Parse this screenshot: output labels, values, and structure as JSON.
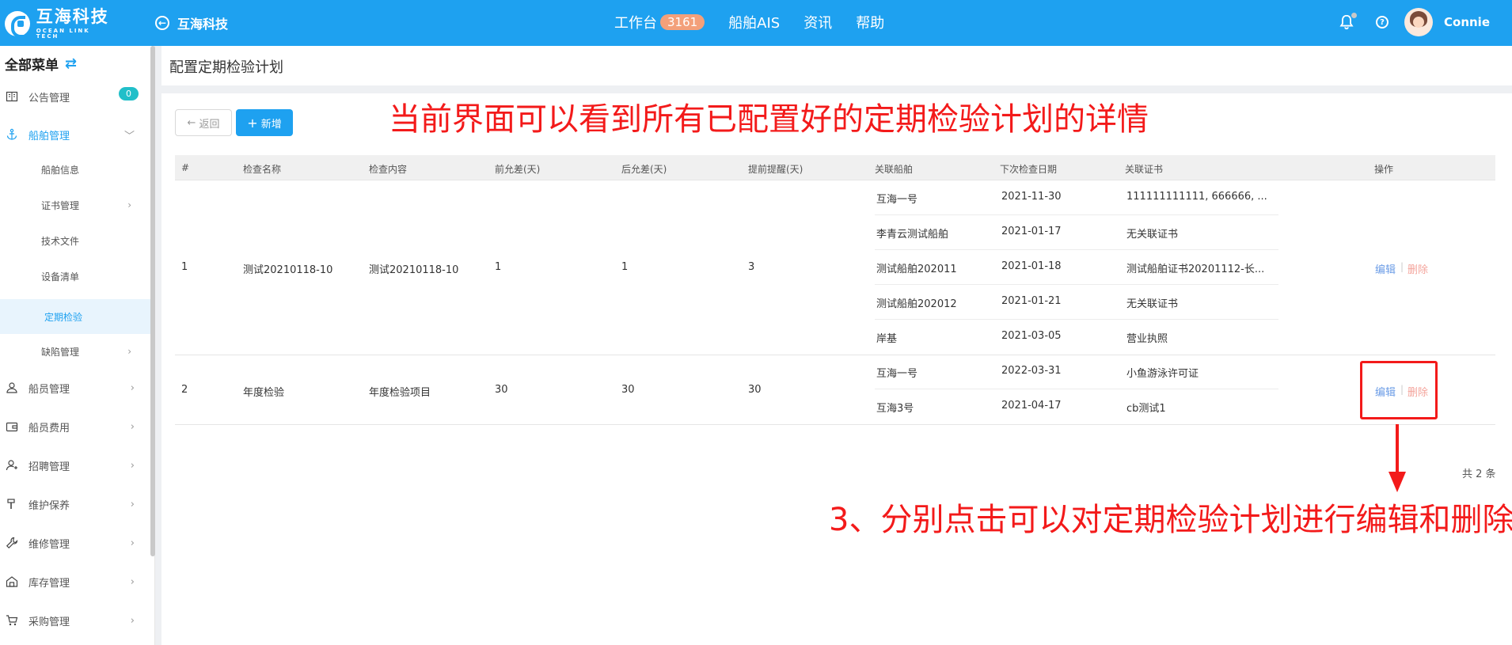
{
  "header": {
    "logo_cn": "互海科技",
    "logo_en": "OCEAN LINK TECH",
    "back_title": "互海科技",
    "nav": [
      {
        "label": "工作台",
        "badge": "3161"
      },
      {
        "label": "船舶AIS"
      },
      {
        "label": "资讯"
      },
      {
        "label": "帮助"
      }
    ],
    "help_icon": "?",
    "username": "Connie"
  },
  "sidebar": {
    "header": "全部菜单",
    "items": [
      {
        "label": "公告管理",
        "icon": "notice-icon",
        "badge": "0"
      },
      {
        "label": "船舶管理",
        "icon": "anchor-icon",
        "expanded": true
      },
      {
        "label": "船员管理",
        "icon": "user-icon"
      },
      {
        "label": "船员费用",
        "icon": "wallet-icon"
      },
      {
        "label": "招聘管理",
        "icon": "recruit-icon"
      },
      {
        "label": "维护保养",
        "icon": "hammer-icon"
      },
      {
        "label": "维修管理",
        "icon": "wrench-icon"
      },
      {
        "label": "库存管理",
        "icon": "warehouse-icon"
      },
      {
        "label": "采购管理",
        "icon": "cart-icon"
      }
    ],
    "submenu": [
      {
        "label": "船舶信息"
      },
      {
        "label": "证书管理",
        "has_children": true
      },
      {
        "label": "技术文件"
      },
      {
        "label": "设备清单"
      },
      {
        "label": "定期检验",
        "active": true
      },
      {
        "label": "缺陷管理",
        "has_children": true
      }
    ]
  },
  "page": {
    "title": "配置定期检验计划",
    "back_button": "返回",
    "new_button": "新增",
    "annotation_top": "当前界面可以看到所有已配置好的定期检验计划的详情",
    "annotation_bottom": "3、分别点击可以对定期检验计划进行编辑和删除",
    "total": "共 2 条"
  },
  "table": {
    "columns": [
      "#",
      "检查名称",
      "检查内容",
      "前允差(天)",
      "后允差(天)",
      "提前提醒(天)",
      "关联船舶",
      "下次检查日期",
      "关联证书",
      "操作"
    ],
    "rows": [
      {
        "index": "1",
        "name": "测试20210118-10",
        "content": "测试20210118-10",
        "before": "1",
        "after": "1",
        "remind": "3",
        "ships": [
          {
            "ship": "互海一号",
            "date": "2021-11-30",
            "cert": "111111111111, 666666, ..."
          },
          {
            "ship": "李青云测试船舶",
            "date": "2021-01-17",
            "cert": "无关联证书"
          },
          {
            "ship": "测试船舶202011",
            "date": "2021-01-18",
            "cert": "测试船舶证书20201112-长..."
          },
          {
            "ship": "测试船舶202012",
            "date": "2021-01-21",
            "cert": "无关联证书"
          },
          {
            "ship": "岸基",
            "date": "2021-03-05",
            "cert": "营业执照"
          }
        ],
        "edit": "编辑",
        "delete": "删除"
      },
      {
        "index": "2",
        "name": "年度检验",
        "content": "年度检验项目",
        "before": "30",
        "after": "30",
        "remind": "30",
        "ships": [
          {
            "ship": "互海一号",
            "date": "2022-03-31",
            "cert": "小鱼游泳许可证"
          },
          {
            "ship": "互海3号",
            "date": "2021-04-17",
            "cert": "cb测试1"
          }
        ],
        "edit": "编辑",
        "delete": "删除"
      }
    ]
  },
  "colors": {
    "primary": "#1ea1f0",
    "annotation": "#f31a1a",
    "badge_work": "#f3a07a",
    "badge_zero": "#21bfc9",
    "edit_link": "#6b9ce6",
    "delete_link": "#f4a49c"
  }
}
